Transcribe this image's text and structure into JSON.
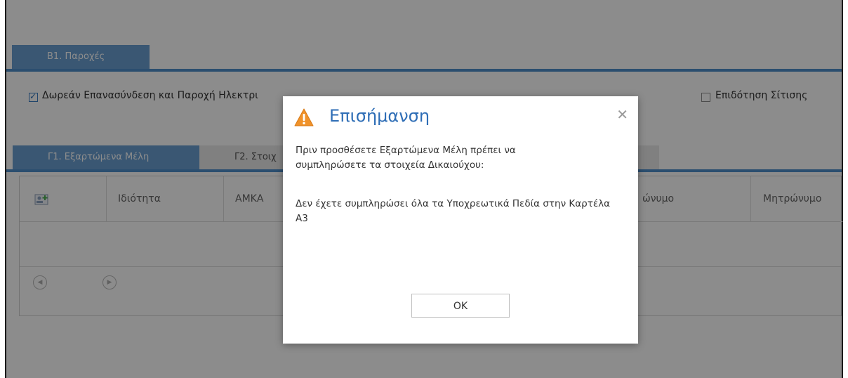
{
  "benefits_tab": {
    "label": "Β1. Παροχές"
  },
  "checkboxes": [
    {
      "label": "Δωρεάν Επανασύνδεση και Παροχή Ηλεκτρι",
      "checked": true
    },
    {
      "label": "Επιδότηση Σίτισης",
      "checked": false
    }
  ],
  "member_tabs": [
    {
      "label": "Γ1. Εξαρτώμενα Μέλη",
      "active": true
    },
    {
      "label": "Γ2. Στοιχ",
      "active": false
    }
  ],
  "grid": {
    "add_icon": "add-member-icon",
    "columns": [
      "Ιδιότητα",
      "ΑΜΚΑ",
      "ώνυμο",
      "Μητρώνυμο"
    ],
    "pager": {
      "prev_icon": "chevron-left-icon",
      "next_icon": "chevron-right-icon"
    }
  },
  "dialog": {
    "title": "Επισήμανση",
    "icon": "warning-icon",
    "close_icon": "close-icon",
    "message_line1": "Πριν προσθέσετε Εξαρτώμενα Μέλη πρέπει να συμπληρώσετε τα στοιχεία Δικαιούχου:",
    "message_line2": "Δεν έχετε συμπληρώσει όλα τα Υποχρεωτικά Πεδία στην Καρτέλα Α3",
    "ok_label": "OK"
  },
  "colors": {
    "accent": "#4f8fcb",
    "tab_active": "#6a9fd2",
    "warning": "#f0922a",
    "title_blue": "#2f6eb6"
  }
}
